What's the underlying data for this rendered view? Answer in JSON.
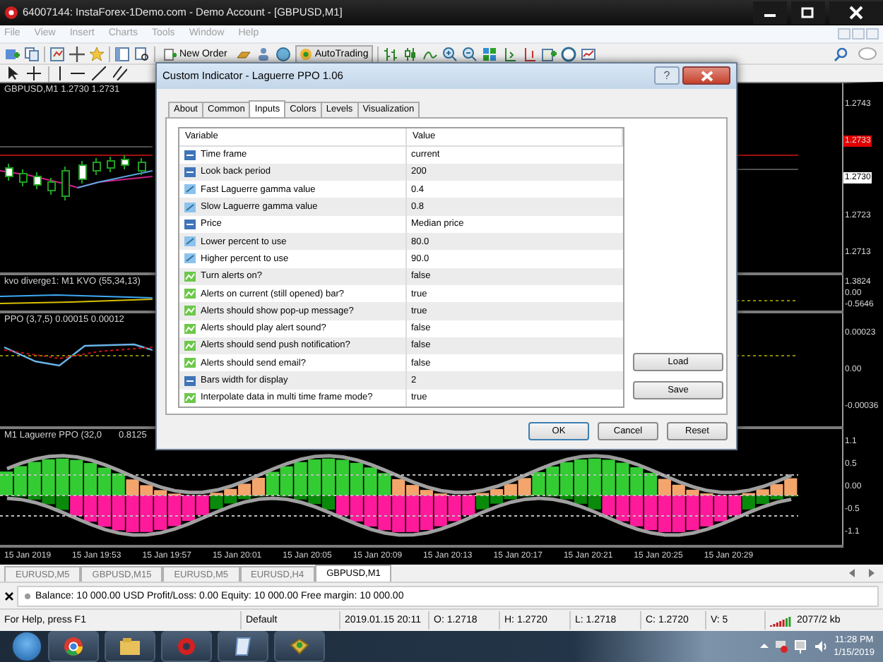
{
  "window": {
    "title": "64007144: InstaForex-1Demo.com - Demo Account - [GBPUSD,M1]"
  },
  "menu": [
    {
      "label": "File",
      "disabled": true
    },
    {
      "label": "View",
      "disabled": true
    },
    {
      "label": "Insert",
      "disabled": true
    },
    {
      "label": "Charts",
      "disabled": true
    },
    {
      "label": "Tools",
      "disabled": true
    },
    {
      "label": "Window",
      "disabled": true
    },
    {
      "label": "Help",
      "disabled": true
    }
  ],
  "toolbar": {
    "new_order": "New Order",
    "auto_trading": "AutoTrading"
  },
  "chart": {
    "panes": [
      {
        "kind": "price",
        "title": "GBPUSD,M1  1.2730 1.2731",
        "axis": [
          {
            "label": "1.2743",
            "kind": "tick"
          },
          {
            "label": "1.2733",
            "kind": "ask"
          },
          {
            "label": "1.2730",
            "kind": "bid"
          },
          {
            "label": "1.2723",
            "kind": "tick"
          },
          {
            "label": "1.2713",
            "kind": "tick"
          }
        ]
      },
      {
        "kind": "kvo",
        "title": "kvo diverge1: M1  KVO (55,34,13)",
        "axis": [
          {
            "label": "1.3824",
            "kind": "tick"
          },
          {
            "label": "0.00",
            "kind": "tick"
          },
          {
            "label": "-0.5646",
            "kind": "tick"
          }
        ]
      },
      {
        "kind": "ppo",
        "title": "PPO (3,7,5) 0.00015 0.00012",
        "axis": [
          {
            "label": "0.00023",
            "kind": "tick"
          },
          {
            "label": "0.00",
            "kind": "tick"
          },
          {
            "label": "-0.00036",
            "kind": "tick"
          }
        ]
      },
      {
        "kind": "histogram",
        "title": "M1 Laguerre PPO (32,0",
        "value": "0.8125",
        "axis": [
          {
            "label": "1.1",
            "kind": "tick"
          },
          {
            "label": "0.5",
            "kind": "tick"
          },
          {
            "label": "0.00",
            "kind": "tick"
          },
          {
            "label": "-0.5",
            "kind": "tick"
          },
          {
            "label": "-1.1",
            "kind": "tick"
          }
        ]
      }
    ],
    "time_axis": [
      "15 Jan 2019",
      "15 Jan 19:53",
      "15 Jan 19:57",
      "15 Jan 20:01",
      "15 Jan 20:05",
      "15 Jan 20:09",
      "15 Jan 20:13",
      "15 Jan 20:17",
      "15 Jan 20:21",
      "15 Jan 20:25",
      "15 Jan 20:29"
    ]
  },
  "chart_tabs": [
    {
      "label": "EURUSD,M5",
      "selected": false
    },
    {
      "label": "GBPUSD,M15",
      "selected": false
    },
    {
      "label": "EURUSD,M5",
      "selected": false
    },
    {
      "label": "EURUSD,H4",
      "selected": false
    },
    {
      "label": "GBPUSD,M1",
      "selected": true
    }
  ],
  "terminal": {
    "account": "Balance: 10 000.00 USD  Profit/Loss: 0.00  Equity: 10 000.00  Free margin: 10 000.00"
  },
  "status_bar": [
    "For Help, press F1",
    "Default",
    "2019.01.15 20:11",
    "O: 1.2718",
    "H: 1.2720",
    "L: 1.2718",
    "C: 1.2720",
    "V: 5",
    "2077/2 kb"
  ],
  "taskbar": {
    "time": "11:28 PM",
    "date": "1/15/2019"
  },
  "dialog": {
    "title": "Custom Indicator - Laguerre PPO 1.06",
    "help": "?",
    "tabs": [
      {
        "label": "About",
        "selected": false
      },
      {
        "label": "Common",
        "selected": false
      },
      {
        "label": "Inputs",
        "selected": true
      },
      {
        "label": "Colors",
        "selected": false
      },
      {
        "label": "Levels",
        "selected": false
      },
      {
        "label": "Visualization",
        "selected": false
      }
    ],
    "columns": [
      "Variable",
      "Value"
    ],
    "rows": [
      {
        "kind": "enum",
        "variable": "Time frame",
        "value": "current"
      },
      {
        "kind": "enum",
        "variable": "Look back period",
        "value": "200"
      },
      {
        "kind": "double",
        "variable": "Fast Laguerre gamma value",
        "value": "0.4"
      },
      {
        "kind": "double",
        "variable": "Slow Laguerre gamma value",
        "value": "0.8"
      },
      {
        "kind": "enum",
        "variable": "Price",
        "value": "Median price"
      },
      {
        "kind": "double",
        "variable": "Lower percent to use",
        "value": "80.0"
      },
      {
        "kind": "double",
        "variable": "Higher percent to use",
        "value": "90.0"
      },
      {
        "kind": "bool",
        "variable": "Turn alerts on?",
        "value": "false"
      },
      {
        "kind": "bool",
        "variable": "Alerts on current (still opened) bar?",
        "value": "true"
      },
      {
        "kind": "bool",
        "variable": "Alerts should show pop-up message?",
        "value": "true"
      },
      {
        "kind": "bool",
        "variable": "Alerts should play alert sound?",
        "value": "false"
      },
      {
        "kind": "bool",
        "variable": "Alerts should send push notification?",
        "value": "false"
      },
      {
        "kind": "bool",
        "variable": "Alerts should send email?",
        "value": "false"
      },
      {
        "kind": "enum",
        "variable": "Bars width for display",
        "value": "2"
      },
      {
        "kind": "bool",
        "variable": "Interpolate data in multi time frame mode?",
        "value": "true"
      }
    ],
    "side_buttons": [
      "Load",
      "Save"
    ],
    "buttons": [
      "OK",
      "Cancel",
      "Reset"
    ]
  }
}
